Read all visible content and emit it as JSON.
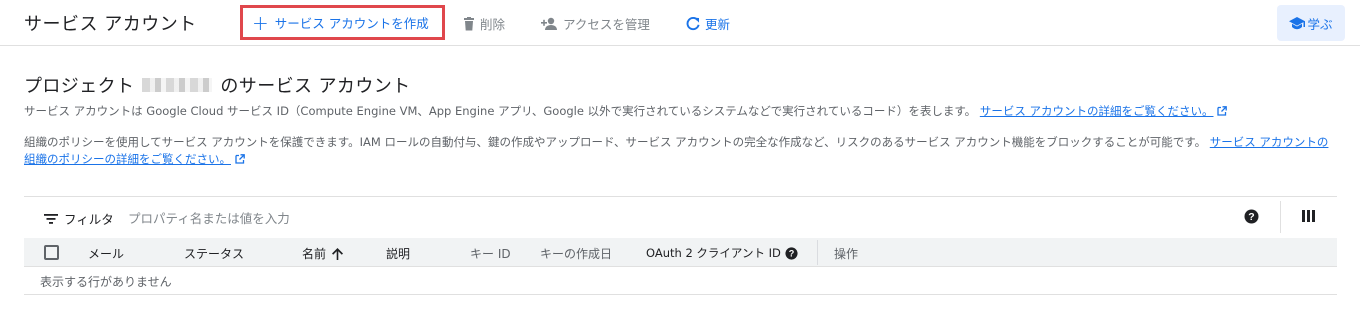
{
  "header": {
    "title": "サービス アカウント",
    "create_button": "サービス アカウントを作成",
    "delete_button": "削除",
    "manage_access_button": "アクセスを管理",
    "refresh_button": "更新",
    "learn_button": "学ぶ"
  },
  "section": {
    "title_prefix": "プロジェクト",
    "title_suffix": "のサービス アカウント",
    "description1": "サービス アカウントは Google Cloud サービス ID（Compute Engine VM、App Engine アプリ、Google 以外で実行されているシステムなどで実行されているコード）を表します。",
    "description1_link": "サービス アカウントの詳細をご覧ください。",
    "description2": "組織のポリシーを使用してサービス アカウントを保護できます。IAM ロールの自動付与、鍵の作成やアップロード、サービス アカウントの完全な作成など、リスクのあるサービス アカウント機能をブロックすることが可能です。",
    "description2_link": "サービス アカウントの組織のポリシーの詳細をご覧ください。"
  },
  "filter": {
    "label": "フィルタ",
    "placeholder": "プロパティ名または値を入力"
  },
  "table": {
    "columns": [
      "メール",
      "ステータス",
      "名前",
      "説明",
      "キー ID",
      "キーの作成日",
      "OAuth 2 クライアント ID",
      "操作"
    ],
    "sort_column": "名前",
    "empty_message": "表示する行がありません"
  },
  "colors": {
    "accent": "#1a73e8",
    "highlight_border": "#e0474c",
    "header_bg": "#f1f3f4"
  },
  "icons": [
    "add-icon",
    "delete-icon",
    "person-add-icon",
    "refresh-icon",
    "school-icon",
    "external-link-icon",
    "filter-icon",
    "help-icon",
    "columns-icon",
    "arrow-up-icon"
  ]
}
